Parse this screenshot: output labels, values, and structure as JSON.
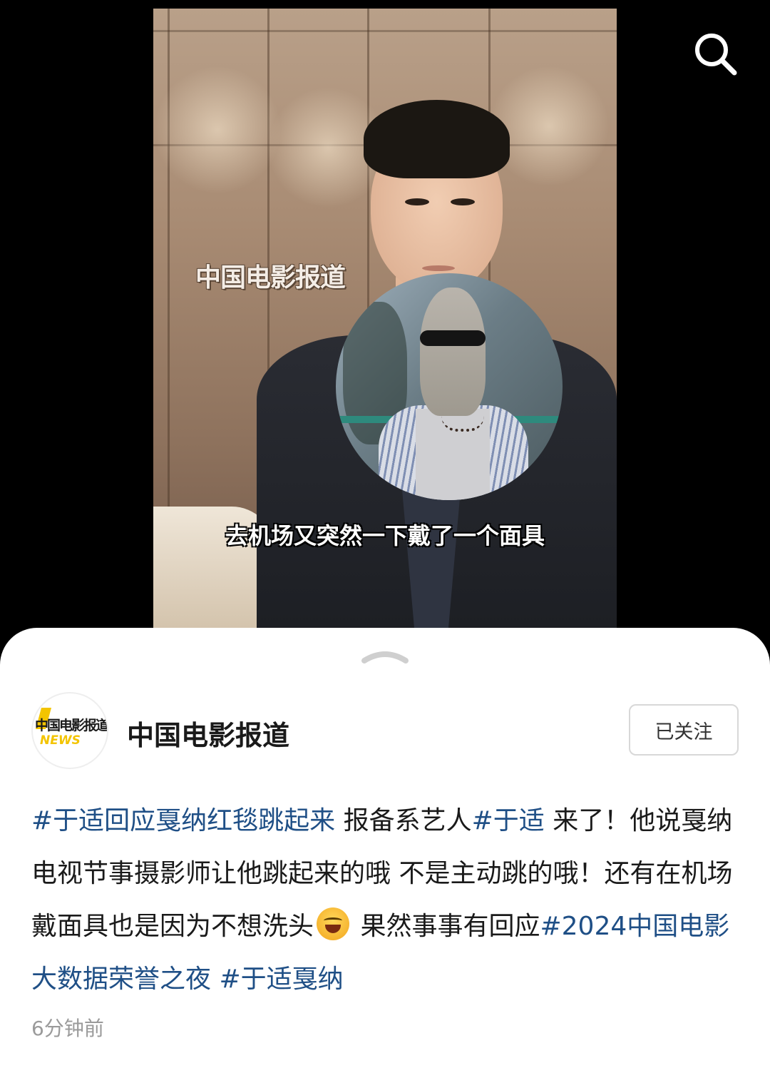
{
  "video": {
    "watermark": "中国电影报道",
    "subtitle": "去机场又突然一下戴了一个面具"
  },
  "search": {
    "icon": "search-icon"
  },
  "post": {
    "account": {
      "name": "中国电影报道",
      "avatar_text": "中国电影报道",
      "avatar_news": "NEWS"
    },
    "follow_label": "已关注",
    "segments": [
      {
        "text": "#于适回应戛纳红毯跳起来",
        "type": "tag"
      },
      {
        "text": " 报备系艺人",
        "type": "text"
      },
      {
        "text": "#于适",
        "type": "tag"
      },
      {
        "text": " 来了！他说戛纳电视节事摄影师让他跳起来的哦 不是主动跳的哦！还有在机场戴面具也是因为不想洗头",
        "type": "text"
      },
      {
        "text": "laugh-cry-emoji",
        "type": "emoji"
      },
      {
        "text": " 果然事事有回应",
        "type": "text"
      },
      {
        "text": "#2024中国电影大数据荣誉之夜",
        "type": "tag"
      },
      {
        "text": " ",
        "type": "text"
      },
      {
        "text": "#于适戛纳",
        "type": "tag"
      }
    ],
    "timestamp": "6分钟前"
  },
  "colors": {
    "tag": "#1f4f86",
    "text": "#1a1a1a",
    "muted": "#9a9a9a",
    "sheet_bg": "#ffffff",
    "backdrop": "#000000"
  }
}
